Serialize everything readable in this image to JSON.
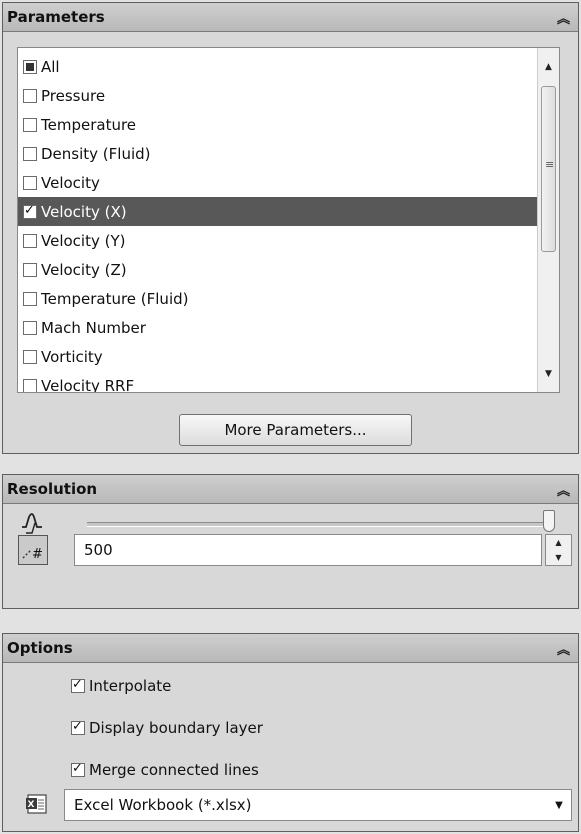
{
  "parameters": {
    "title": "Parameters",
    "items": [
      {
        "label": "All",
        "state": "partial"
      },
      {
        "label": "Pressure",
        "state": "unchecked"
      },
      {
        "label": "Temperature",
        "state": "unchecked"
      },
      {
        "label": "Density (Fluid)",
        "state": "unchecked"
      },
      {
        "label": "Velocity",
        "state": "unchecked"
      },
      {
        "label": "Velocity (X)",
        "state": "checked",
        "selected": true
      },
      {
        "label": "Velocity (Y)",
        "state": "unchecked"
      },
      {
        "label": "Velocity (Z)",
        "state": "unchecked"
      },
      {
        "label": "Temperature (Fluid)",
        "state": "unchecked"
      },
      {
        "label": "Mach Number",
        "state": "unchecked"
      },
      {
        "label": "Vorticity",
        "state": "unchecked"
      },
      {
        "label": "Velocity RRF",
        "state": "unchecked"
      }
    ],
    "more_button": "More Parameters..."
  },
  "resolution": {
    "title": "Resolution",
    "slider_value": 1.0,
    "value": "500"
  },
  "options": {
    "title": "Options",
    "interpolate": "Interpolate",
    "display_boundary": "Display boundary layer",
    "merge_lines": "Merge connected lines",
    "format": "Excel Workbook (*.xlsx)"
  },
  "icons": {
    "collapse": "double-chevron-up-icon",
    "wave": "resolution-wave-icon",
    "number": "number-entry-icon",
    "excel": "excel-icon"
  }
}
